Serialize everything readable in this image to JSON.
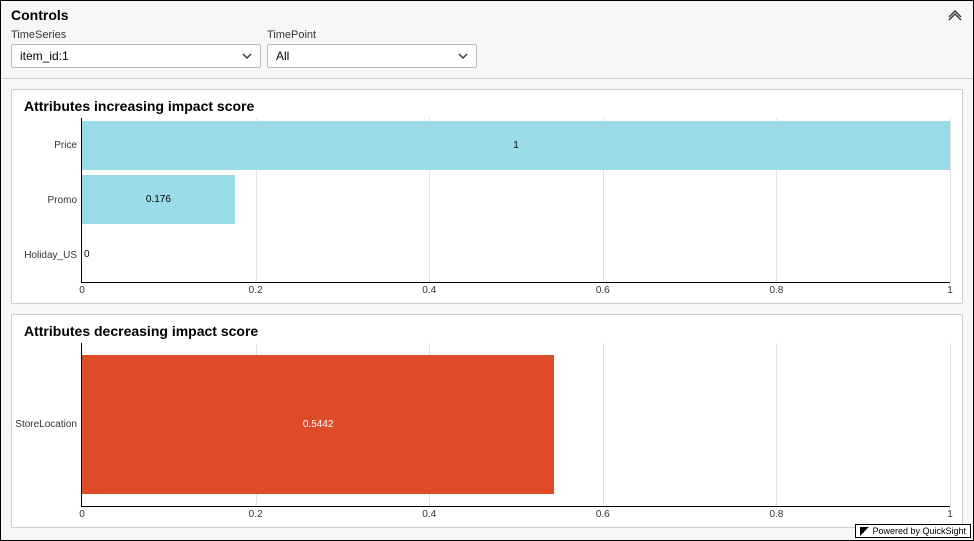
{
  "controls": {
    "title": "Controls",
    "timeSeries": {
      "label": "TimeSeries",
      "value": "item_id:1"
    },
    "timePoint": {
      "label": "TimePoint",
      "value": "All"
    }
  },
  "chart_data": [
    {
      "type": "bar",
      "title": "Attributes increasing impact score",
      "orientation": "horizontal",
      "categories": [
        "Price",
        "Promo",
        "Holiday_US"
      ],
      "values": [
        1,
        0.176,
        0
      ],
      "xlabel": "",
      "ylabel": "",
      "xlim": [
        0,
        1
      ],
      "xticks": [
        0,
        0.2,
        0.4,
        0.6,
        0.8,
        1
      ],
      "color": "#9adbe8",
      "data_label_color": "#000"
    },
    {
      "type": "bar",
      "title": "Attributes decreasing impact score",
      "orientation": "horizontal",
      "categories": [
        "StoreLocation"
      ],
      "values": [
        0.5442
      ],
      "xlabel": "",
      "ylabel": "",
      "xlim": [
        0,
        1
      ],
      "xticks": [
        0,
        0.2,
        0.4,
        0.6,
        0.8,
        1
      ],
      "color": "#dd4b28",
      "data_label_color": "#fff"
    }
  ],
  "footer": {
    "text": "Powered by QuickSight"
  }
}
